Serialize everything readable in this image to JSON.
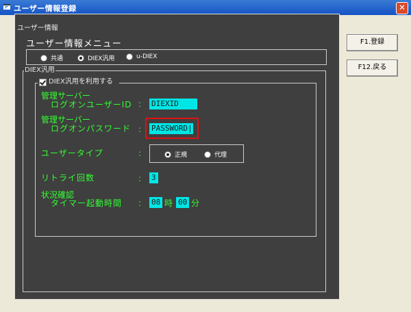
{
  "window": {
    "title": "ユーザー情報登録",
    "close_glyph": "✕"
  },
  "user_group": {
    "label": "ユーザー情報",
    "menu_title": "ユーザー情報メニュー"
  },
  "mode_radios": [
    {
      "label": "共通",
      "checked": false
    },
    {
      "label": "DIEX汎用",
      "checked": true
    },
    {
      "label": "u-DIEX",
      "checked": false
    }
  ],
  "diex_group": {
    "label": "DIEX汎用",
    "use_checkbox_label": "DIEX汎用を利用する",
    "use_checked": true
  },
  "fields": {
    "logon_user_id_label_line1": "管理サーバー",
    "logon_user_id_label_line2": "ログオンユーザーID",
    "logon_user_id_value": "DIEXID",
    "logon_password_label_line1": "管理サーバー",
    "logon_password_label_line2": "ログオンパスワード",
    "logon_password_value": "PASSWORD|",
    "user_type_label": "ユーザータイプ",
    "retry_label": "リトライ回数",
    "retry_value": "3",
    "timer_label_line1": "状況確認",
    "timer_label_line2": "タイマー起動時間",
    "timer_hour": "08",
    "hour_unit": "時",
    "timer_minute": "00",
    "minute_unit": "分",
    "colon": ":"
  },
  "user_type_radios": [
    {
      "label": "正規",
      "checked": true
    },
    {
      "label": "代理",
      "checked": false
    }
  ],
  "buttons": {
    "register": "F1.登録",
    "back": "F12.戻る"
  },
  "colors": {
    "panel": "#3f3f3f",
    "label_green": "#33ff33",
    "field_cyan": "#00e6e6",
    "highlight_red": "#e01010",
    "titlebar": "#1553c4"
  }
}
